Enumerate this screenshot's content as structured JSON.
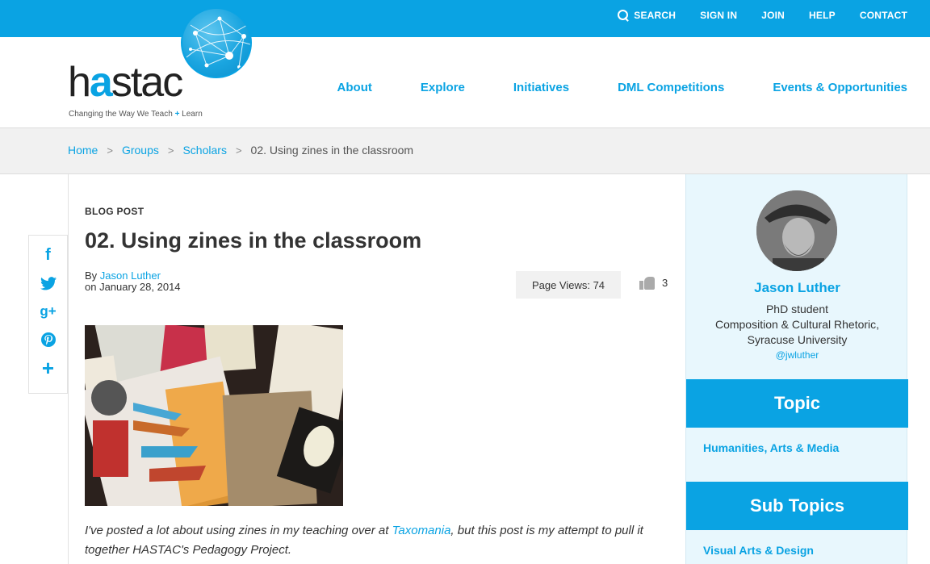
{
  "topbar": {
    "search": "SEARCH",
    "signin": "SIGN IN",
    "join": "JOIN",
    "help": "HELP",
    "contact": "CONTACT"
  },
  "logo": {
    "prefix": "h",
    "accent": "a",
    "suffix": "stac",
    "tagline_main": "Changing the Way We Teach ",
    "tagline_plus": "+",
    "tagline_end": " Learn"
  },
  "nav": {
    "about": "About",
    "explore": "Explore",
    "initiatives": "Initiatives",
    "dml": "DML Competitions",
    "events": "Events & Opportunities"
  },
  "breadcrumb": {
    "home": "Home",
    "groups": "Groups",
    "scholars": "Scholars",
    "current": "02. Using zines in the classroom",
    "separator": ">"
  },
  "share": {
    "facebook": "f",
    "googleplus": "g+",
    "plus": "+"
  },
  "post": {
    "type": "BLOG POST",
    "title": "02. Using zines in the classroom",
    "by_label": "By ",
    "author": "Jason Luther",
    "date": "on January 28, 2014",
    "page_views": "Page Views: 74",
    "likes": "3",
    "excerpt_before": "I've posted a lot about using zines in my teaching over at ",
    "excerpt_link": "Taxomania",
    "excerpt_after": ", but this post is my attempt to pull it together HASTAC's Pedagogy Project."
  },
  "sidebar": {
    "author_name": "Jason Luther",
    "role": "PhD student",
    "department": "Composition & Cultural Rhetoric,",
    "university": "Syracuse University",
    "handle": "@jwluther",
    "topic_heading": "Topic",
    "topic": "Humanities, Arts & Media",
    "subtopics_heading": "Sub Topics",
    "subtopic": "Visual Arts & Design"
  },
  "colors": {
    "brand": "#0aa3e3",
    "sidebar_bg": "#e8f7fd"
  }
}
